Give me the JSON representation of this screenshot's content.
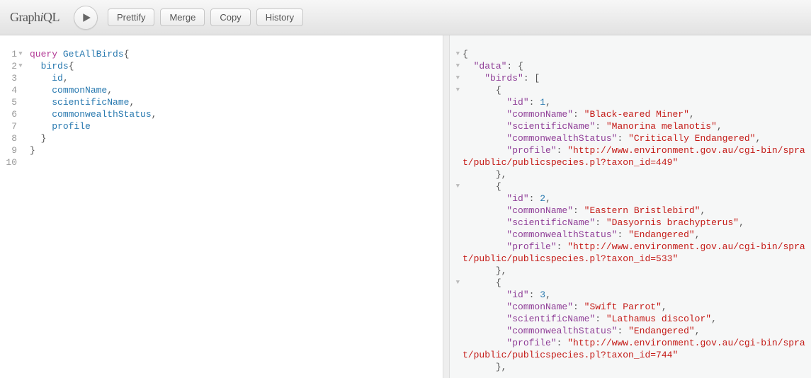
{
  "app": {
    "name": "GraphiQL"
  },
  "toolbar": {
    "prettify": "Prettify",
    "merge": "Merge",
    "copy": "Copy",
    "history": "History"
  },
  "editor": {
    "line_count": 10,
    "fold_lines": [
      1,
      2
    ],
    "lines": [
      [
        [
          "kw",
          "query"
        ],
        [
          "text",
          " "
        ],
        [
          "def",
          "GetAllBirds"
        ],
        [
          "punct",
          "{"
        ]
      ],
      [
        [
          "text",
          "  "
        ],
        [
          "attr",
          "birds"
        ],
        [
          "punct",
          "{"
        ]
      ],
      [
        [
          "text",
          "    "
        ],
        [
          "attr",
          "id"
        ],
        [
          "punct",
          ","
        ]
      ],
      [
        [
          "text",
          "    "
        ],
        [
          "attr",
          "commonName"
        ],
        [
          "punct",
          ","
        ]
      ],
      [
        [
          "text",
          "    "
        ],
        [
          "attr",
          "scientificName"
        ],
        [
          "punct",
          ","
        ]
      ],
      [
        [
          "text",
          "    "
        ],
        [
          "attr",
          "commonwealthStatus"
        ],
        [
          "punct",
          ","
        ]
      ],
      [
        [
          "text",
          "    "
        ],
        [
          "attr",
          "profile"
        ]
      ],
      [
        [
          "text",
          "  "
        ],
        [
          "punct",
          "}"
        ]
      ],
      [
        [
          "punct",
          "}"
        ]
      ],
      []
    ]
  },
  "result": {
    "fold_lines": [
      0,
      1,
      2,
      3,
      11,
      19
    ],
    "lines": [
      [
        [
          "brace",
          "{"
        ]
      ],
      [
        [
          "text",
          "  "
        ],
        [
          "key",
          "\"data\""
        ],
        [
          "brace",
          ": {"
        ]
      ],
      [
        [
          "text",
          "    "
        ],
        [
          "key",
          "\"birds\""
        ],
        [
          "brace",
          ": ["
        ]
      ],
      [
        [
          "text",
          "      "
        ],
        [
          "brace",
          "{"
        ]
      ],
      [
        [
          "text",
          "        "
        ],
        [
          "key",
          "\"id\""
        ],
        [
          "brace",
          ": "
        ],
        [
          "num",
          "1"
        ],
        [
          "brace",
          ","
        ]
      ],
      [
        [
          "text",
          "        "
        ],
        [
          "key",
          "\"commonName\""
        ],
        [
          "brace",
          ": "
        ],
        [
          "str",
          "\"Black-eared Miner\""
        ],
        [
          "brace",
          ","
        ]
      ],
      [
        [
          "text",
          "        "
        ],
        [
          "key",
          "\"scientificName\""
        ],
        [
          "brace",
          ": "
        ],
        [
          "str",
          "\"Manorina melanotis\""
        ],
        [
          "brace",
          ","
        ]
      ],
      [
        [
          "text",
          "        "
        ],
        [
          "key",
          "\"commonwealthStatus\""
        ],
        [
          "brace",
          ": "
        ],
        [
          "str",
          "\"Critically Endangered\""
        ],
        [
          "brace",
          ","
        ]
      ],
      [
        [
          "text",
          "        "
        ],
        [
          "key",
          "\"profile\""
        ],
        [
          "brace",
          ": "
        ],
        [
          "str",
          "\"http://www.environment.gov.au/cgi-bin/sprat/public/publicspecies.pl?taxon_id=449\""
        ]
      ],
      [
        [
          "text",
          "      "
        ],
        [
          "brace",
          "},"
        ]
      ],
      [
        [
          "text",
          "      "
        ],
        [
          "brace",
          "{"
        ]
      ],
      [
        [
          "text",
          "        "
        ],
        [
          "key",
          "\"id\""
        ],
        [
          "brace",
          ": "
        ],
        [
          "num",
          "2"
        ],
        [
          "brace",
          ","
        ]
      ],
      [
        [
          "text",
          "        "
        ],
        [
          "key",
          "\"commonName\""
        ],
        [
          "brace",
          ": "
        ],
        [
          "str",
          "\"Eastern Bristlebird\""
        ],
        [
          "brace",
          ","
        ]
      ],
      [
        [
          "text",
          "        "
        ],
        [
          "key",
          "\"scientificName\""
        ],
        [
          "brace",
          ": "
        ],
        [
          "str",
          "\"Dasyornis brachypterus\""
        ],
        [
          "brace",
          ","
        ]
      ],
      [
        [
          "text",
          "        "
        ],
        [
          "key",
          "\"commonwealthStatus\""
        ],
        [
          "brace",
          ": "
        ],
        [
          "str",
          "\"Endangered\""
        ],
        [
          "brace",
          ","
        ]
      ],
      [
        [
          "text",
          "        "
        ],
        [
          "key",
          "\"profile\""
        ],
        [
          "brace",
          ": "
        ],
        [
          "str",
          "\"http://www.environment.gov.au/cgi-bin/sprat/public/publicspecies.pl?taxon_id=533\""
        ]
      ],
      [
        [
          "text",
          "      "
        ],
        [
          "brace",
          "},"
        ]
      ],
      [
        [
          "text",
          "      "
        ],
        [
          "brace",
          "{"
        ]
      ],
      [
        [
          "text",
          "        "
        ],
        [
          "key",
          "\"id\""
        ],
        [
          "brace",
          ": "
        ],
        [
          "num",
          "3"
        ],
        [
          "brace",
          ","
        ]
      ],
      [
        [
          "text",
          "        "
        ],
        [
          "key",
          "\"commonName\""
        ],
        [
          "brace",
          ": "
        ],
        [
          "str",
          "\"Swift Parrot\""
        ],
        [
          "brace",
          ","
        ]
      ],
      [
        [
          "text",
          "        "
        ],
        [
          "key",
          "\"scientificName\""
        ],
        [
          "brace",
          ": "
        ],
        [
          "str",
          "\"Lathamus discolor\""
        ],
        [
          "brace",
          ","
        ]
      ],
      [
        [
          "text",
          "        "
        ],
        [
          "key",
          "\"commonwealthStatus\""
        ],
        [
          "brace",
          ": "
        ],
        [
          "str",
          "\"Endangered\""
        ],
        [
          "brace",
          ","
        ]
      ],
      [
        [
          "text",
          "        "
        ],
        [
          "key",
          "\"profile\""
        ],
        [
          "brace",
          ": "
        ],
        [
          "str",
          "\"http://www.environment.gov.au/cgi-bin/sprat/public/publicspecies.pl?taxon_id=744\""
        ]
      ],
      [
        [
          "text",
          "      "
        ],
        [
          "brace",
          "},"
        ]
      ]
    ]
  }
}
